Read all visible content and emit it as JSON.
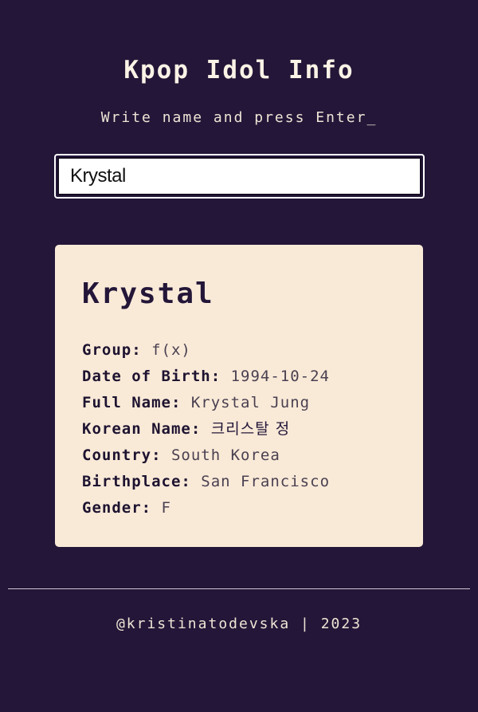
{
  "header": {
    "title": "Kpop Idol Info",
    "instructions": "Write name and press Enter_"
  },
  "search": {
    "value": "Krystal",
    "placeholder": ""
  },
  "idol": {
    "name": "Krystal",
    "fields": [
      {
        "label": "Group:",
        "value": "f(x)"
      },
      {
        "label": "Date of Birth:",
        "value": "1994-10-24"
      },
      {
        "label": "Full Name:",
        "value": "Krystal Jung"
      },
      {
        "label": "Korean Name:",
        "value": "크리스탈 정"
      },
      {
        "label": "Country:",
        "value": "South Korea"
      },
      {
        "label": "Birthplace:",
        "value": "San Francisco"
      },
      {
        "label": "Gender:",
        "value": "F"
      }
    ]
  },
  "footer": {
    "text": "@kristinatodevska | 2023"
  },
  "colors": {
    "background": "#231638",
    "card": "#f9ead8",
    "text_light": "#f5ebdc",
    "text_dark": "#231638"
  }
}
